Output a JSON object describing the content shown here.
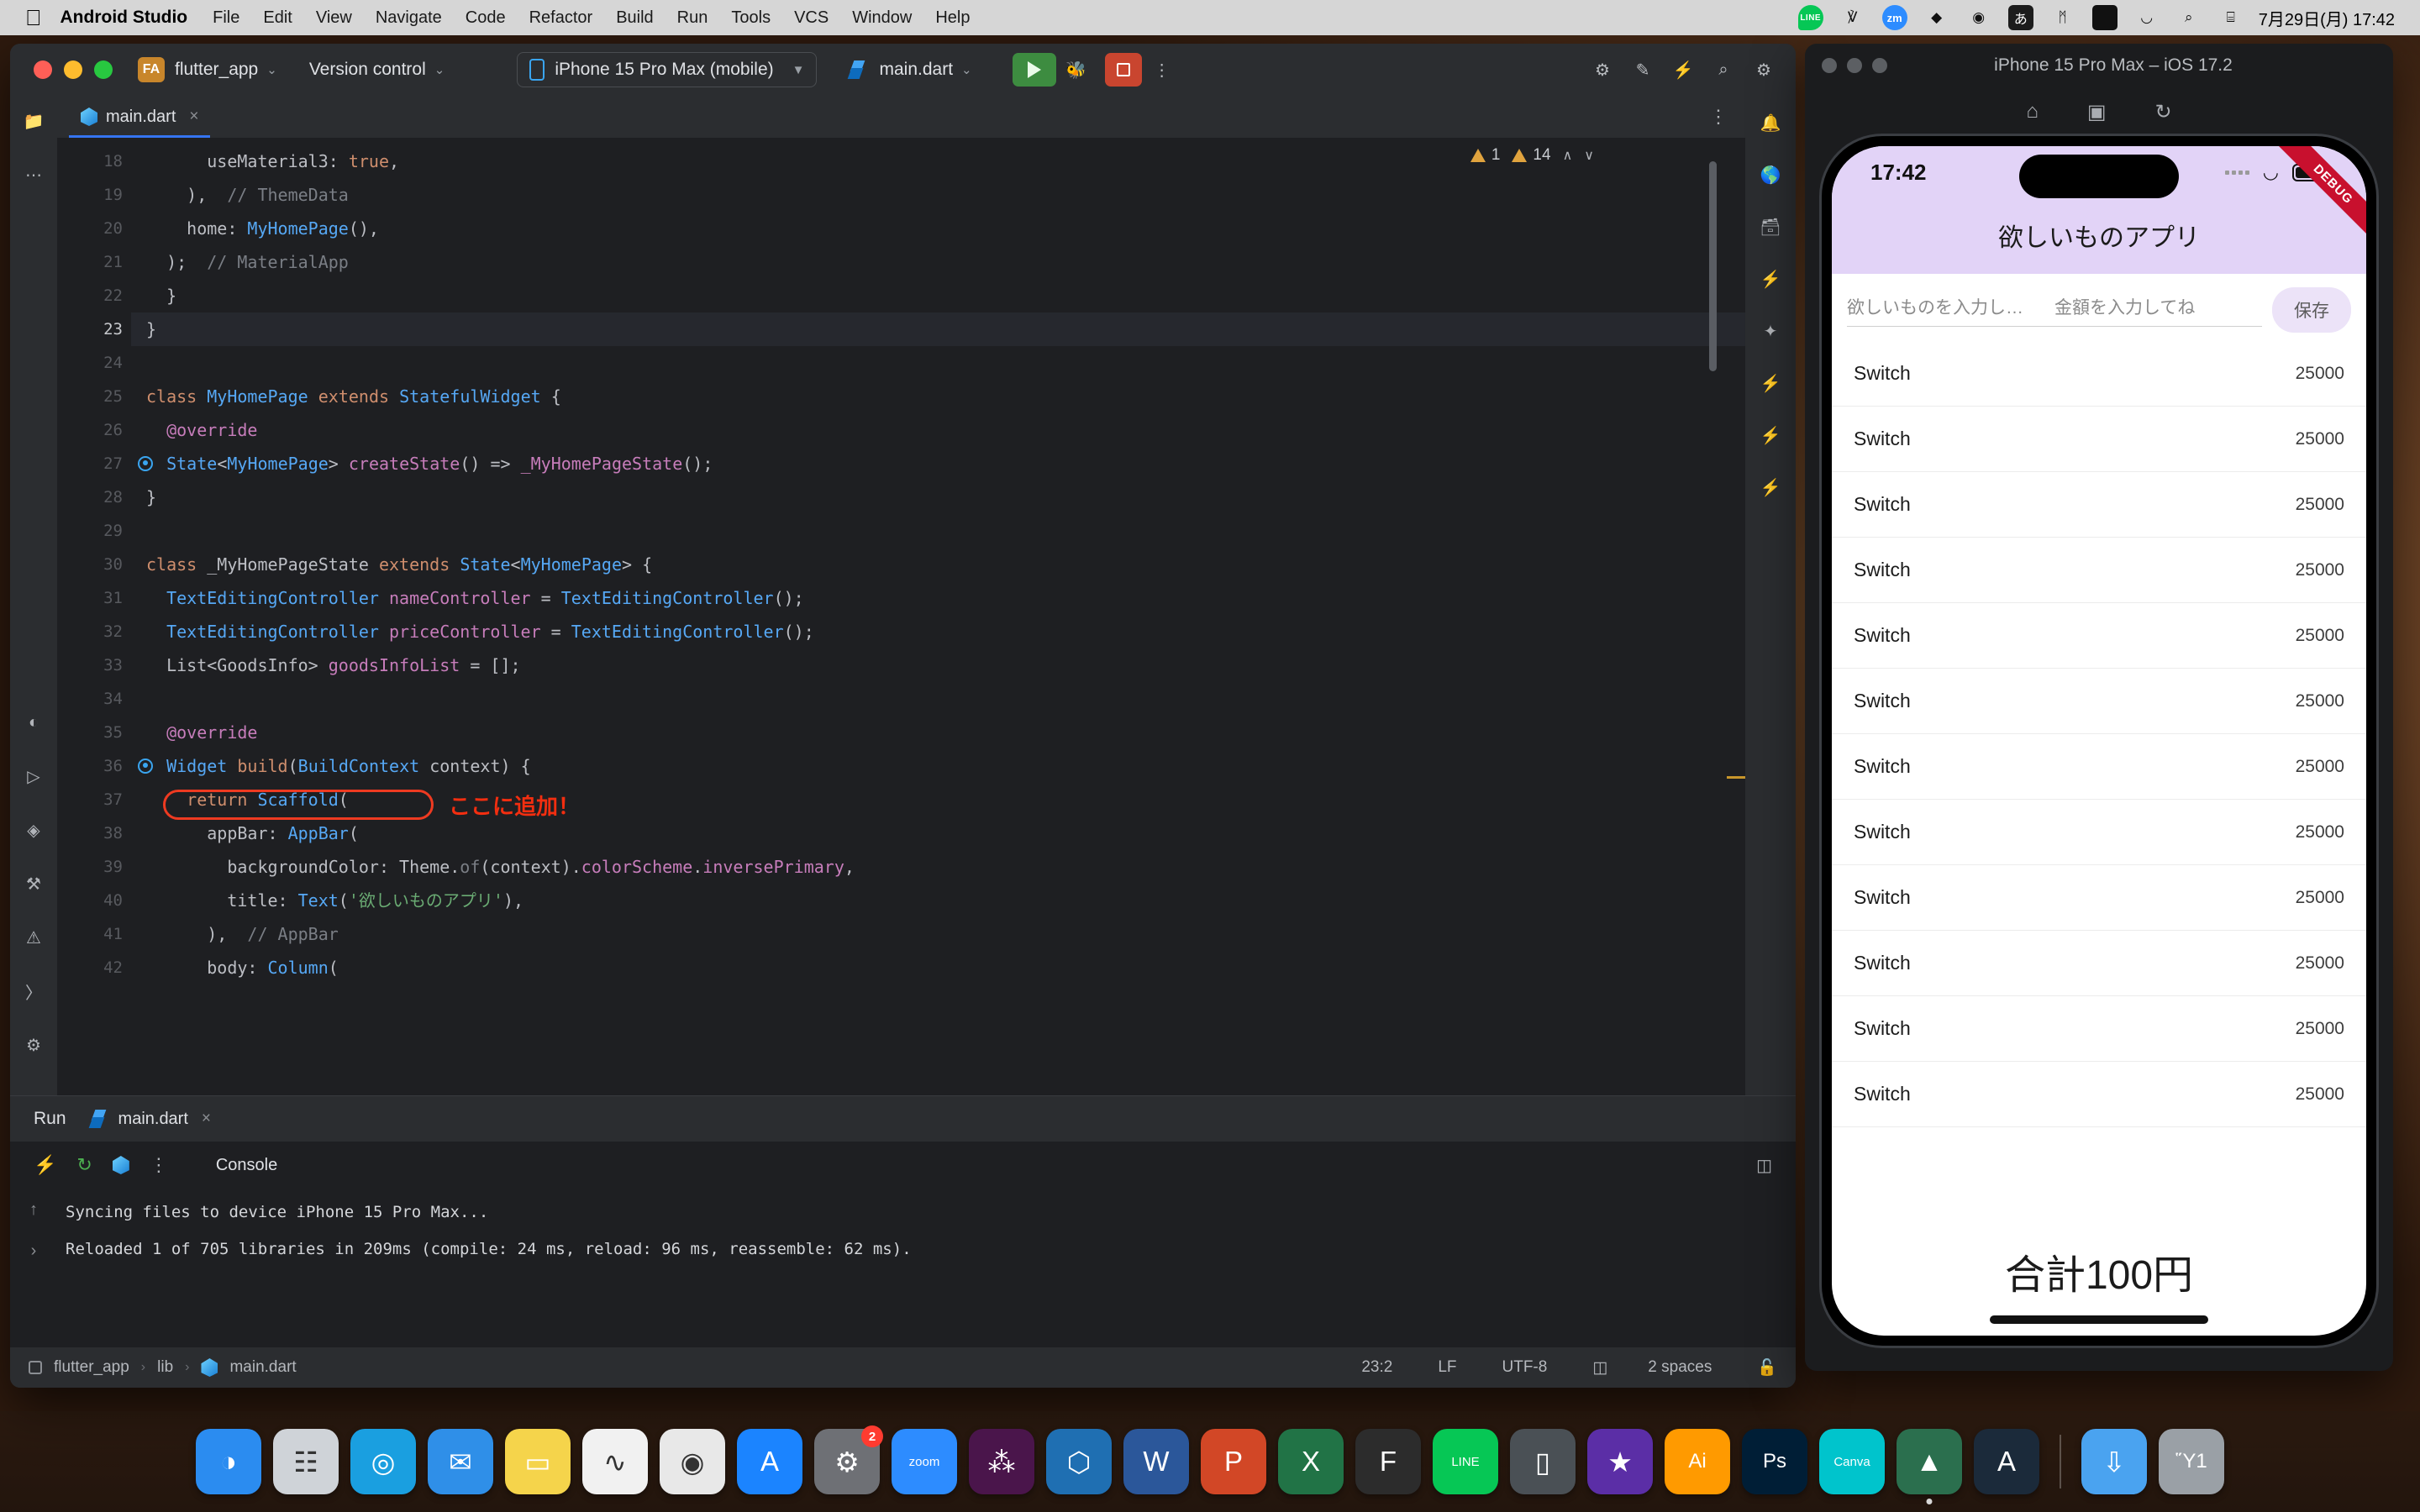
{
  "menubar": {
    "apple": "",
    "app": "Android Studio",
    "items": [
      "File",
      "Edit",
      "View",
      "Navigate",
      "Code",
      "Refactor",
      "Build",
      "Run",
      "Tools",
      "VCS",
      "Window",
      "Help"
    ],
    "tray": [
      {
        "name": "line-icon",
        "glyph": "LINE"
      },
      {
        "name": "figma-icon",
        "glyph": "F"
      },
      {
        "name": "zoom-icon",
        "glyph": "zm"
      },
      {
        "name": "sketch-icon",
        "glyph": "◆"
      },
      {
        "name": "notion-icon",
        "glyph": "◌"
      },
      {
        "name": "input-method-icon",
        "glyph": "あ"
      },
      {
        "name": "bluetooth-icon",
        "glyph": "ᛗ"
      },
      {
        "name": "battery-icon",
        "glyph": "■"
      },
      {
        "name": "wifi-icon",
        "glyph": "◠"
      },
      {
        "name": "spotlight-search-icon",
        "glyph": "⌕"
      },
      {
        "name": "control-center-icon",
        "glyph": "⌸"
      }
    ],
    "clock": "7月29日(月) 17:42"
  },
  "ide": {
    "toolbar": {
      "project_badge": "FA",
      "project_name": "flutter_app",
      "version_control": "Version control",
      "device": "iPhone 15 Pro Max (mobile)",
      "run_config": "main.dart",
      "caret": "⌄",
      "dropdown_arrow": "▼"
    },
    "tab": {
      "label": "main.dart",
      "close": "×",
      "kebab": "⋮"
    },
    "warnings": {
      "error_count": "1",
      "warning_count": "14",
      "up": "∧",
      "down": "∨"
    },
    "editor": {
      "lines": [
        {
          "n": "18",
          "html": "      useMaterial3: <span class='kw'>true</span>,"
        },
        {
          "n": "19",
          "html": "    ),  <span class='cmt'>// ThemeData</span>"
        },
        {
          "n": "20",
          "html": "    home: <span class='typ'>MyHomePage</span>(),"
        },
        {
          "n": "21",
          "html": "  );  <span class='cmt'>// MaterialApp</span>"
        },
        {
          "n": "22",
          "html": "  }"
        },
        {
          "n": "23",
          "html": "}",
          "current": true
        },
        {
          "n": "24",
          "html": ""
        },
        {
          "n": "25",
          "html": "<span class='kw'>class</span> <span class='typ'>MyHomePage</span> <span class='kw'>extends</span> <span class='typ'>StatefulWidget</span> {"
        },
        {
          "n": "26",
          "html": "  <span class='fld'>@override</span>"
        },
        {
          "n": "27",
          "html": "  <span class='typ'>State</span>&lt;<span class='typ'>MyHomePage</span>&gt; <span class='fld'>createState</span>() =&gt; <span class='fld'>_MyHomePageState</span>();",
          "gmark": true
        },
        {
          "n": "28",
          "html": "}"
        },
        {
          "n": "29",
          "html": ""
        },
        {
          "n": "30",
          "html": "<span class='kw'>class</span> _MyHomePageState <span class='kw'>extends</span> <span class='typ'>State</span>&lt;<span class='typ'>MyHomePage</span>&gt; {"
        },
        {
          "n": "31",
          "html": "  <span class='typ'>TextEditingController</span> <span class='fld'>nameController</span> = <span class='typ'>TextEditingController</span>();"
        },
        {
          "n": "32",
          "html": "  <span class='typ'>TextEditingController</span> <span class='fld'>priceController</span> = <span class='typ'>TextEditingController</span>();"
        },
        {
          "n": "33",
          "html": "  <span class='pl'>List&lt;GoodsInfo&gt;</span> <span class='fld'>goodsInfoList</span> = [];"
        },
        {
          "n": "34",
          "html": ""
        },
        {
          "n": "35",
          "html": "  <span class='fld'>@override</span>"
        },
        {
          "n": "36",
          "html": "  <span class='typ'>Widget</span> <span class='kw'>build</span>(<span class='typ'>BuildContext</span> context) {",
          "gmark": true
        },
        {
          "n": "37",
          "html": "    <span class='kw'>return</span> <span class='typ'>Scaffold</span>("
        },
        {
          "n": "38",
          "html": "      appBar: <span class='typ'>AppBar</span>("
        },
        {
          "n": "39",
          "html": "        backgroundColor: Theme.<span class='cmt'>of</span>(context).<span class='fld'>colorScheme</span>.<span class='fld'>inversePrimary</span>,"
        },
        {
          "n": "40",
          "html": "        title: <span class='typ'>Text</span>(<span class='str'>'欲しいものアプリ'</span>),"
        },
        {
          "n": "41",
          "html": "      ),  <span class='cmt'>// AppBar</span>"
        },
        {
          "n": "42",
          "html": "      body: <span class='typ'>Column</span>("
        }
      ],
      "annotation": "ここに追加！",
      "annotation_color": "#f32e10"
    },
    "run_window": {
      "title": "Run",
      "tab_label": "main.dart",
      "tab_close": "×",
      "console_label": "Console",
      "output": [
        "Syncing files to device iPhone 15 Pro Max...",
        "Reloaded 1 of 705 libraries in 209ms (compile: 24 ms, reload: 96 ms, reassemble: 62 ms)."
      ]
    },
    "statusbar": {
      "project": "flutter_app",
      "folder": "lib",
      "file": "main.dart",
      "caret_pos": "23:2",
      "line_sep": "LF",
      "encoding": "UTF-8",
      "indent": "2 spaces",
      "sep": "›"
    }
  },
  "simulator": {
    "window_title": "iPhone 15 Pro Max – iOS 17.2",
    "tools": [
      {
        "name": "home-icon",
        "glyph": "⌂"
      },
      {
        "name": "screenshot-icon",
        "glyph": "▣"
      },
      {
        "name": "rotate-icon",
        "glyph": "↻"
      }
    ],
    "ios": {
      "time": "17:42",
      "debug_ribbon": "DEBUG"
    },
    "app": {
      "title": "欲しいものアプリ",
      "appbar_color": "#e2d3f7",
      "name_placeholder": "欲しいものを入力し…",
      "price_placeholder": "金額を入力してね",
      "save_label": "保存",
      "rows": [
        {
          "name": "Switch",
          "price": "25000"
        },
        {
          "name": "Switch",
          "price": "25000"
        },
        {
          "name": "Switch",
          "price": "25000"
        },
        {
          "name": "Switch",
          "price": "25000"
        },
        {
          "name": "Switch",
          "price": "25000"
        },
        {
          "name": "Switch",
          "price": "25000"
        },
        {
          "name": "Switch",
          "price": "25000"
        },
        {
          "name": "Switch",
          "price": "25000"
        },
        {
          "name": "Switch",
          "price": "25000"
        },
        {
          "name": "Switch",
          "price": "25000"
        },
        {
          "name": "Switch",
          "price": "25000"
        },
        {
          "name": "Switch",
          "price": "25000"
        }
      ],
      "total": "合計100円"
    }
  },
  "dock": {
    "items": [
      {
        "name": "finder",
        "glyph": "◑",
        "color": "#2b8cf0"
      },
      {
        "name": "launchpad",
        "glyph": "☷",
        "color": "#cfd3d8"
      },
      {
        "name": "safari",
        "glyph": "◎",
        "color": "#1a9fe0"
      },
      {
        "name": "mail",
        "glyph": "✉",
        "color": "#2f8fe8"
      },
      {
        "name": "notes",
        "glyph": "▭",
        "color": "#f5d44b"
      },
      {
        "name": "activity-monitor",
        "glyph": "∿",
        "color": "#f1f1f1"
      },
      {
        "name": "chrome",
        "glyph": "◉",
        "color": "#e8e8e8"
      },
      {
        "name": "app-store",
        "glyph": "A",
        "color": "#1b84ff"
      },
      {
        "name": "system-settings",
        "glyph": "⚙",
        "color": "#6e7075",
        "badge": "2"
      },
      {
        "name": "zoom",
        "glyph": "zoom",
        "color": "#2d8cff"
      },
      {
        "name": "slack",
        "glyph": "⁂",
        "color": "#4a154b"
      },
      {
        "name": "vscode",
        "glyph": "⬡",
        "color": "#1f6fb2"
      },
      {
        "name": "word",
        "glyph": "W",
        "color": "#2b579a"
      },
      {
        "name": "powerpoint",
        "glyph": "P",
        "color": "#d24726"
      },
      {
        "name": "excel",
        "glyph": "X",
        "color": "#217346"
      },
      {
        "name": "figma",
        "glyph": "F",
        "color": "#2c2c2c"
      },
      {
        "name": "line",
        "glyph": "LINE",
        "color": "#06c755"
      },
      {
        "name": "simulator",
        "glyph": "▯",
        "color": "#4a5055"
      },
      {
        "name": "imovie",
        "glyph": "★",
        "color": "#5b2ea6"
      },
      {
        "name": "illustrator",
        "glyph": "Ai",
        "color": "#ff9a00"
      },
      {
        "name": "photoshop",
        "glyph": "Ps",
        "color": "#001e36"
      },
      {
        "name": "canva",
        "glyph": "Canva",
        "color": "#00c4cc"
      },
      {
        "name": "android-studio",
        "glyph": "▲",
        "color": "#2b6f4e",
        "running": true
      },
      {
        "name": "android-studio-preview",
        "glyph": "A",
        "color": "#1b2a3a"
      },
      {
        "name": "downloads",
        "glyph": "⇩",
        "color": "#4aa3f0"
      },
      {
        "name": "trash",
        "glyph": "Ὕ1",
        "color": "#9aa0a6"
      }
    ]
  }
}
